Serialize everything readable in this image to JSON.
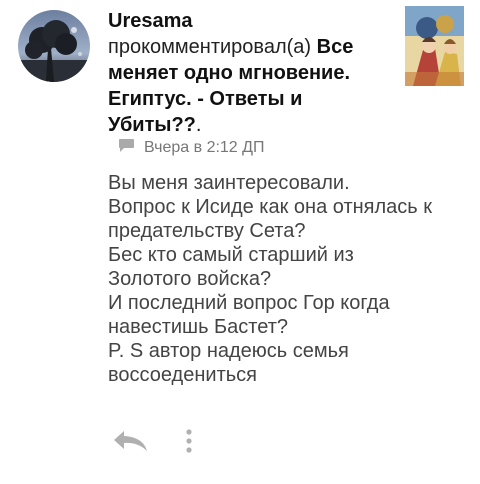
{
  "comment": {
    "username": "Uresama",
    "action": "прокомментировал(а)",
    "story_title": "Все меняет одно мгновение. Египтус. - Ответы и Убиты??",
    "title_end": ".",
    "timestamp": "Вчера в 2:12 ДП",
    "text": "Вы меня заинтересовали.\nВопрос к Исиде как она отнялась к предательству Сета?\nБес кто самый старший из Золотого войска?\nИ последний вопрос Гор когда навестишь Бастет?\nP. S автор надеюсь семья воссоедениться"
  },
  "icons": {
    "timestamp": "speech-bubble-icon",
    "reply": "reply-icon",
    "more": "more-vertical-icon"
  },
  "colors": {
    "text": "#444444",
    "meta": "#777777",
    "icon": "#b0b0b0"
  }
}
